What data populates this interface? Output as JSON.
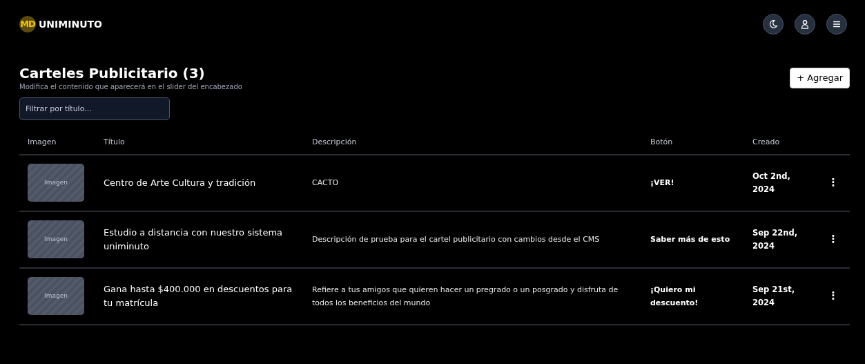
{
  "brand": {
    "logo": "MD",
    "name": "UNIMINUTO"
  },
  "page": {
    "title": "Carteles Publicitario (3)",
    "subtitle": "Modifica el contenido que aparecerá en el slider del encabezado",
    "filter": {
      "placeholder": "Filtrar por título..."
    },
    "add_button": "+ Agregar"
  },
  "table": {
    "columns": [
      "Imagen",
      "Título",
      "Descripción",
      "Botón",
      "Creado"
    ],
    "rows": [
      {
        "image": "Imagen",
        "title": "Centro de Arte Cultura y tradición",
        "description": "CACTO",
        "button": "¡VER!",
        "created": "Oct 2nd, 2024",
        "menu": "⋮"
      },
      {
        "image": "Imagen",
        "title": "Estudio a distancia con nuestro sistema uniminuto",
        "description": "Descripción de prueba para el cartel publicitario con cambios desde el CMS",
        "button": "Saber más de esto",
        "created": "Sep 22nd, 2024",
        "menu": "⋮"
      },
      {
        "image": "Imagen",
        "title": "Gana hasta $400.000 en descuentos para tu matrícula",
        "description": "Refiere a tus amigos que quieren hacer un pregrado o un posgrado y disfruta de todos los beneficios del mundo",
        "button": "¡Quiero mi descuento!",
        "created": "Sep 21st, 2024",
        "menu": "⋮"
      }
    ]
  }
}
